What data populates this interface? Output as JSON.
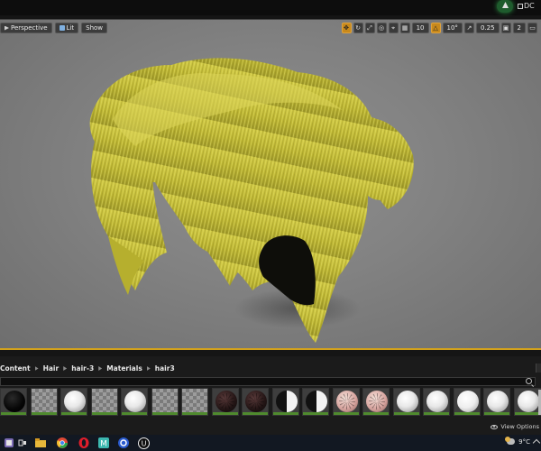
{
  "window": {
    "top_right_label": "DC",
    "top_right_icon": "layout-icon",
    "profile_icon": "ue-account-icon"
  },
  "viewport": {
    "perspective_label": "Perspective",
    "lit_label": "Lit",
    "show_label": "Show",
    "grid_snap_value": "10",
    "rotation_snap_value": "10°",
    "scale_snap_value": "0.25",
    "camera_speed_value": "2",
    "accent_color": "#d3a21b",
    "hair_color": "#c4bd3a"
  },
  "content_browser": {
    "breadcrumb": [
      "Content",
      "Hair",
      "hair-3",
      "Materials",
      "hair3"
    ],
    "view_options_label": "View Options",
    "search_placeholder": "",
    "thumbnails": [
      {
        "type": "black"
      },
      {
        "type": "checker"
      },
      {
        "type": "white"
      },
      {
        "type": "checker"
      },
      {
        "type": "white"
      },
      {
        "type": "checker"
      },
      {
        "type": "checker"
      },
      {
        "type": "dark"
      },
      {
        "type": "dark"
      },
      {
        "type": "half"
      },
      {
        "type": "half"
      },
      {
        "type": "skin"
      },
      {
        "type": "skin"
      },
      {
        "type": "white"
      },
      {
        "type": "white"
      },
      {
        "type": "wavy"
      },
      {
        "type": "white"
      },
      {
        "type": "white"
      }
    ]
  },
  "taskbar": {
    "temperature": "9°C",
    "apps": [
      "file-explorer-icon",
      "task-view-icon",
      "chrome-icon",
      "opera-icon",
      "maya-icon",
      "c4d-icon",
      "unreal-engine-icon"
    ]
  }
}
